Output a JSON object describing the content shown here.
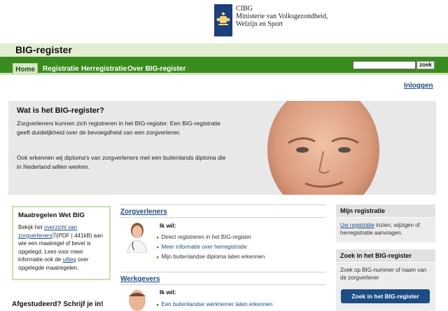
{
  "org": {
    "name": "CIBG",
    "ministry_line1": "Ministerie van Volksgezondheid,",
    "ministry_line2": "Welzijn en Sport"
  },
  "site_title": "BIG-register",
  "nav": {
    "tabs": [
      "Home",
      "Registratie",
      "Herregistratie",
      "Over BIG-register"
    ],
    "active": "Home",
    "search_value": "",
    "search_button": "zoek"
  },
  "login_link": "Inloggen",
  "hero": {
    "title": "Wat is het BIG-register?",
    "para1": "Zorgverleners kunnen zich registreren in het BIG-register. Een BIG-registratie geeft duidelijkheid over de bevoegdheid van een zorgverlener.",
    "para2": "Ook erkennen wij diploma's van zorgverleners met een buitenlands diploma die in Nederland willen werken."
  },
  "maatregelen": {
    "title": "Maatregelen Wet BIG",
    "t1": "Bekijk het ",
    "link1": "overzicht van zorgverleners",
    "t2": "(PDF | 441kB) aan wie een maatregel of bevel is opgelegd. Lees voor meer informatie ook de ",
    "link2": "uitleg",
    "t3": " over opgelegde maatregelen."
  },
  "afgestudeerd": "Afgestudeerd? Schrijf je in!",
  "zorgverleners": {
    "title": "Zorgverleners",
    "ikwil": "Ik wil:",
    "items": [
      "Direct registreren in het BIG-register",
      "Meer informatie over herregistratie",
      "Mijn buitenlandse diploma laten erkennen"
    ]
  },
  "werkgevers": {
    "title": "Werkgevers",
    "ikwil": "Ik wil:",
    "items": [
      "Een buitenlandse werknemer laten erkennen"
    ]
  },
  "mijn_registratie": {
    "title": "Mijn registratie",
    "link": "Uw registratie",
    "text": " inzien, wijzigen of herregistratie aanvragen."
  },
  "zoek_box": {
    "title": "Zoek in het BIG-register",
    "text": "Zoek op BIG-nummer of naam van de zorgverlener",
    "button": "Zoek in het BIG-register"
  },
  "colors": {
    "nav_green": "#3b8c1e",
    "link_blue": "#1d4d85",
    "coat_blue": "#1c3f7a"
  }
}
